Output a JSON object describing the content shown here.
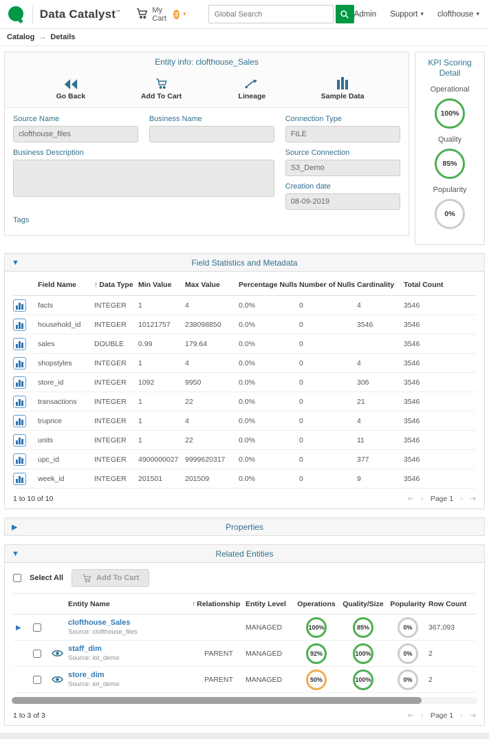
{
  "icons": {
    "collapse_expanded": "▼",
    "collapse_collapsed": "▶",
    "sort_asc": "↑",
    "breadcrumb_arrow": "→",
    "caret_down": "▾",
    "pagination_first": "⇤",
    "pagination_prev": "‹",
    "pagination_next": "›",
    "pagination_last": "⇥",
    "expand_row": "▶"
  },
  "colors": {
    "brand_green": "#009845",
    "label_blue": "#31708f",
    "link_blue": "#337ab7",
    "ring_green": "#4caf50",
    "ring_orange": "#f0ad4e",
    "ring_gray": "#cccccc",
    "badge_orange": "#f0a63c"
  },
  "navbar": {
    "brand": "Data Catalyst",
    "brand_mark": "™",
    "cart": {
      "label": "My Cart",
      "count": "3"
    },
    "search": {
      "placeholder": "Global Search"
    },
    "menu": {
      "admin": "Admin",
      "support": "Support",
      "user": "clofthouse"
    }
  },
  "breadcrumb": {
    "section": "Catalog",
    "page": "Details"
  },
  "entity_info": {
    "title": "Entity info: clofthouse_Sales",
    "actions": {
      "go_back": "Go Back",
      "add_to_cart": "Add To Cart",
      "lineage": "Lineage",
      "sample_data": "Sample Data"
    },
    "fields": {
      "source_name": {
        "label": "Source Name",
        "value": "clofthouse_files"
      },
      "business_name": {
        "label": "Business Name",
        "value": ""
      },
      "connection_type": {
        "label": "Connection Type",
        "value": "FILE"
      },
      "business_description": {
        "label": "Business Description",
        "value": ""
      },
      "source_connection": {
        "label": "Source Connection",
        "value": "S3_Demo"
      },
      "creation_date": {
        "label": "Creation date",
        "value": "08-09-2019"
      },
      "tags": {
        "label": "Tags"
      }
    }
  },
  "kpi": {
    "title": "KPI Scoring Detail",
    "items": [
      {
        "label": "Operational",
        "value": "100%",
        "color": "#4caf50"
      },
      {
        "label": "Quality",
        "value": "85%",
        "color": "#4caf50"
      },
      {
        "label": "Popularity",
        "value": "0%",
        "color": "#cccccc"
      }
    ]
  },
  "field_stats": {
    "title": "Field Statistics and Metadata",
    "columns": {
      "field_name": "Field Name",
      "data_type": "Data Type",
      "min": "Min Value",
      "max": "Max Value",
      "pct_nulls": "Percentage Nulls",
      "num_nulls": "Number of Nulls",
      "cardinality": "Cardinality",
      "total": "Total Count"
    },
    "rows": [
      {
        "field_name": "facts",
        "data_type": "INTEGER",
        "min": "1",
        "max": "4",
        "pct_nulls": "0.0%",
        "num_nulls": "0",
        "cardinality": "4",
        "total": "3546"
      },
      {
        "field_name": "household_id",
        "data_type": "INTEGER",
        "min": "10121757",
        "max": "238098850",
        "pct_nulls": "0.0%",
        "num_nulls": "0",
        "cardinality": "3546",
        "total": "3546"
      },
      {
        "field_name": "sales",
        "data_type": "DOUBLE",
        "min": "0.99",
        "max": "179.64",
        "pct_nulls": "0.0%",
        "num_nulls": "0",
        "cardinality": "",
        "total": "3546"
      },
      {
        "field_name": "shopstyles",
        "data_type": "INTEGER",
        "min": "1",
        "max": "4",
        "pct_nulls": "0.0%",
        "num_nulls": "0",
        "cardinality": "4",
        "total": "3546"
      },
      {
        "field_name": "store_id",
        "data_type": "INTEGER",
        "min": "1092",
        "max": "9950",
        "pct_nulls": "0.0%",
        "num_nulls": "0",
        "cardinality": "306",
        "total": "3546"
      },
      {
        "field_name": "transactions",
        "data_type": "INTEGER",
        "min": "1",
        "max": "22",
        "pct_nulls": "0.0%",
        "num_nulls": "0",
        "cardinality": "21",
        "total": "3546"
      },
      {
        "field_name": "truprice",
        "data_type": "INTEGER",
        "min": "1",
        "max": "4",
        "pct_nulls": "0.0%",
        "num_nulls": "0",
        "cardinality": "4",
        "total": "3546"
      },
      {
        "field_name": "units",
        "data_type": "INTEGER",
        "min": "1",
        "max": "22",
        "pct_nulls": "0.0%",
        "num_nulls": "0",
        "cardinality": "11",
        "total": "3546"
      },
      {
        "field_name": "upc_id",
        "data_type": "INTEGER",
        "min": "4900000027",
        "max": "9999620317",
        "pct_nulls": "0.0%",
        "num_nulls": "0",
        "cardinality": "377",
        "total": "3546"
      },
      {
        "field_name": "week_id",
        "data_type": "INTEGER",
        "min": "201501",
        "max": "201509",
        "pct_nulls": "0.0%",
        "num_nulls": "0",
        "cardinality": "9",
        "total": "3546"
      }
    ],
    "footer": "1 to 10 of 10",
    "page": "Page 1"
  },
  "properties": {
    "title": "Properties"
  },
  "related": {
    "title": "Related Entities",
    "select_all": "Select All",
    "add_to_cart": "Add To Cart",
    "columns": {
      "entity_name": "Entity Name",
      "relationship": "Relationship",
      "entity_level": "Entity Level",
      "operations": "Operations",
      "quality": "Quality/Size",
      "popularity": "Popularity",
      "row_count": "Row Count"
    },
    "rows": [
      {
        "name": "clofthouse_Sales",
        "source": "Source: clofthouse_files",
        "relationship": "",
        "level": "MANAGED",
        "operations": "100%",
        "operations_color": "#4caf50",
        "quality": "85%",
        "quality_color": "#4caf50",
        "popularity": "0%",
        "popularity_color": "#cccccc",
        "row_count": "367,093",
        "expand": true,
        "eye": false
      },
      {
        "name": "staff_dim",
        "source": "Source: iot_demo",
        "relationship": "PARENT",
        "level": "MANAGED",
        "operations": "92%",
        "operations_color": "#4caf50",
        "quality": "100%",
        "quality_color": "#4caf50",
        "popularity": "0%",
        "popularity_color": "#cccccc",
        "row_count": "2",
        "expand": false,
        "eye": true
      },
      {
        "name": "store_dim",
        "source": "Source: iot_demo",
        "relationship": "PARENT",
        "level": "MANAGED",
        "operations": "50%",
        "operations_color": "#f0ad4e",
        "quality": "100%",
        "quality_color": "#4caf50",
        "popularity": "0%",
        "popularity_color": "#cccccc",
        "row_count": "2",
        "expand": false,
        "eye": true
      }
    ],
    "footer": "1 to 3 of 3",
    "page": "Page 1"
  }
}
